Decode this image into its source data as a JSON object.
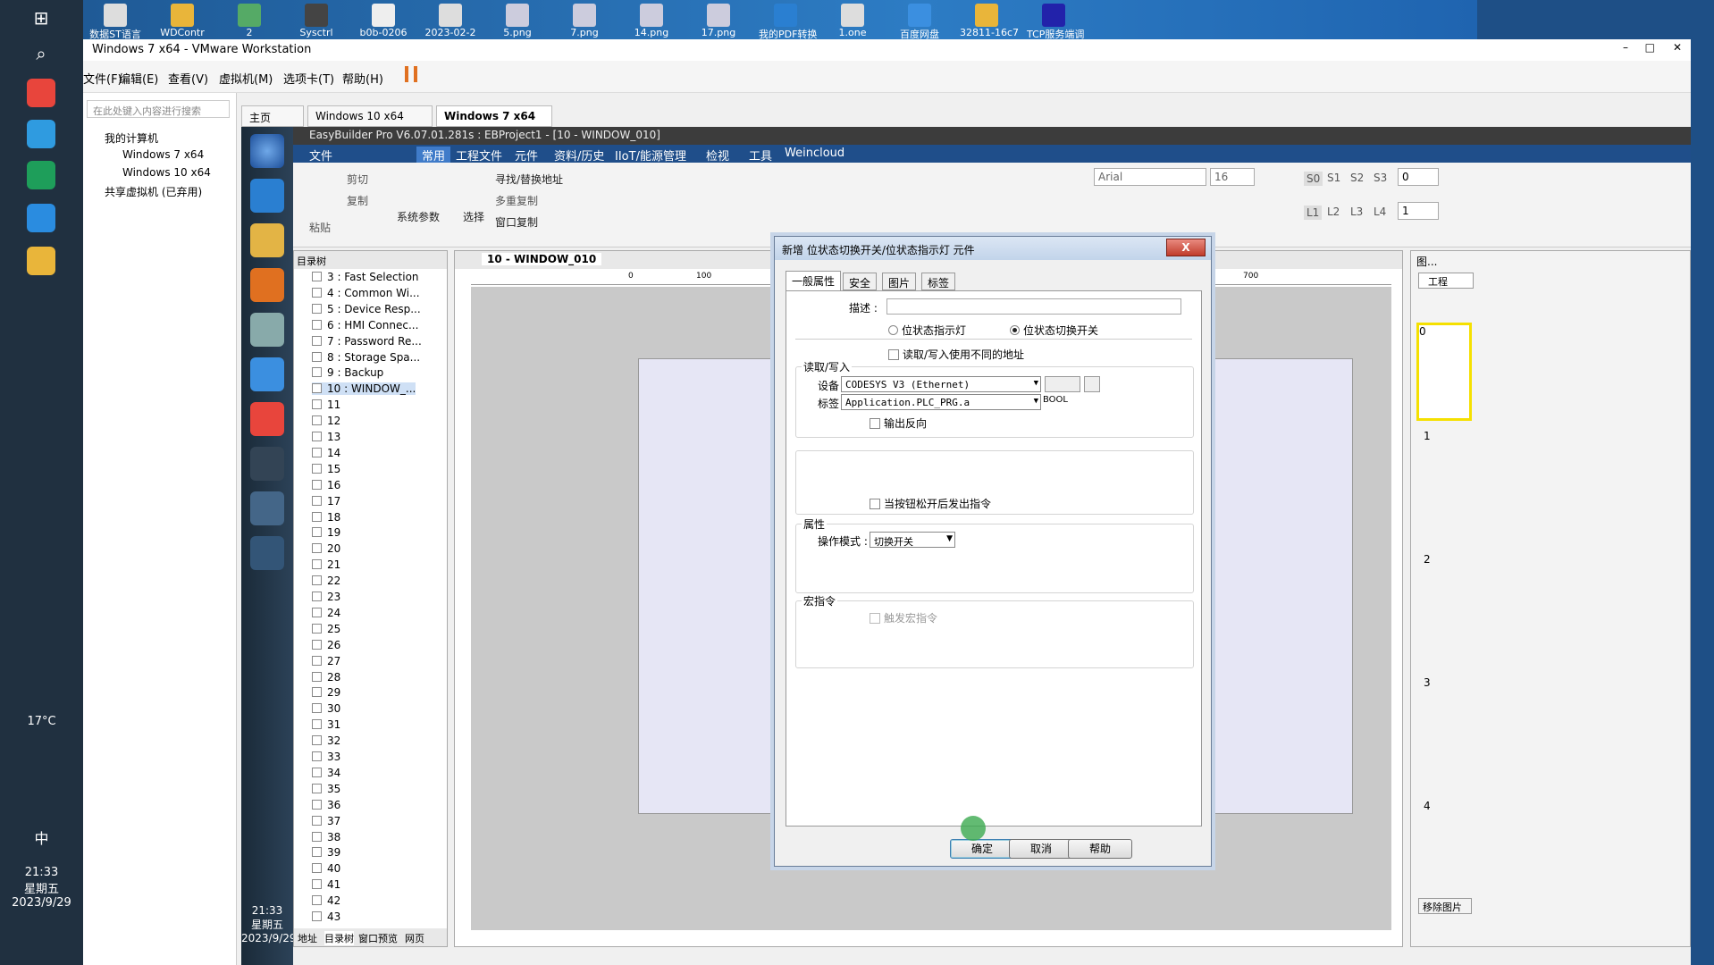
{
  "desktop": {
    "icons": [
      "数据ST语言",
      "WDContr",
      "2",
      "Sysctrl",
      "b0b-0206",
      "2023-02-2",
      "5.png",
      "7.png",
      "14.png",
      "17.png",
      "我的PDF转换",
      "1.one",
      "百度网盘",
      "32811-16c7",
      "TCP服务端调"
    ],
    "tray": {
      "temp": "17°C",
      "ime": "中",
      "time": "21:33",
      "weekday": "星期五",
      "date": "2023/9/29"
    }
  },
  "vmware": {
    "title": "Windows 7 x64 - VMware Workstation",
    "menu": [
      "文件(F)",
      "编辑(E)",
      "查看(V)",
      "虚拟机(M)",
      "选项卡(T)",
      "帮助(H)"
    ],
    "search_placeholder": "在此处键入内容进行搜索",
    "library": {
      "root": "我的计算机",
      "vms": [
        "Windows 7 x64",
        "Windows 10 x64"
      ],
      "shared": "共享虚拟机 (已弃用)"
    },
    "tabs": [
      "主页",
      "Windows 10 x64",
      "Windows 7 x64"
    ]
  },
  "guest": {
    "tray": {
      "time": "21:33",
      "weekday": "星期五",
      "date": "2023/9/29"
    }
  },
  "eb": {
    "title": "EasyBuilder Pro V6.07.01.281s : EBProject1 - [10 - WINDOW_010]",
    "menu": [
      "文件",
      "工程文件",
      "元件",
      "资料/历史",
      "IIoT/能源管理",
      "检视",
      "工具",
      "Weincloud"
    ],
    "active_menu": "常用",
    "ribbon": {
      "paste": "粘贴",
      "cut": "剪切",
      "copy": "复制",
      "sys": "系统参数",
      "select": "选择",
      "find": "寻找/替换地址",
      "multi": "多重复制",
      "wincopy": "窗口复制",
      "font": "Arial",
      "size": "16",
      "s_labels": [
        "S0",
        "S1",
        "S2",
        "S3"
      ],
      "s_value": "0",
      "l_labels": [
        "L1",
        "L2",
        "L3",
        "L4"
      ],
      "l_value": "1"
    },
    "tree_title": "目录树",
    "tree_items": [
      "3 : Fast Selection",
      "4 : Common Wi...",
      "5 : Device Resp...",
      "6 : HMI Connec...",
      "7 : Password Re...",
      "8 : Storage Spa...",
      "9 : Backup",
      "10 : WINDOW_...",
      "11",
      "12",
      "13",
      "14",
      "15",
      "16",
      "17",
      "18",
      "19",
      "20",
      "21",
      "22",
      "23",
      "24",
      "25",
      "26",
      "27",
      "28",
      "29",
      "30",
      "31",
      "32",
      "33",
      "34",
      "35",
      "36",
      "37",
      "38",
      "39",
      "40",
      "41",
      "42",
      "43"
    ],
    "bottom_tabs": [
      "地址",
      "目录树",
      "窗口预览",
      "网页"
    ],
    "editor_tab": "10 - WINDOW_010",
    "ruler": [
      "0",
      "100",
      "700"
    ],
    "right_panel": {
      "title": "图...",
      "btn": "工程",
      "pages": [
        "0",
        "1",
        "2",
        "3",
        "4"
      ],
      "remove": "移除图片"
    }
  },
  "dialog": {
    "title": "新增 位状态切换开关/位状态指示灯 元件",
    "close": "X",
    "tabs": [
      "一般属性",
      "安全",
      "图片",
      "标签"
    ],
    "desc_label": "描述 :",
    "radio_indicator": "位状态指示灯",
    "radio_switch": "位状态切换开关",
    "diff_addr": "读取/写入使用不同的地址",
    "rw_group": "读取/写入",
    "device_label": "设备 :",
    "device_value": "CODESYS V3 (Ethernet)",
    "tag_label": "标签 :",
    "tag_value": "Application.PLC_PRG.a",
    "tag_type": "BOOL",
    "invert": "输出反向",
    "release": "当按钮松开后发出指令",
    "attr_group": "属性",
    "mode_label": "操作模式 :",
    "mode_value": "切换开关",
    "macro_group": "宏指令",
    "macro_trigger": "触发宏指令",
    "ok": "确定",
    "cancel": "取消",
    "help": "帮助"
  },
  "colors": {
    "accent": "#1f4e8a",
    "canvas": "#e6e6f5"
  }
}
